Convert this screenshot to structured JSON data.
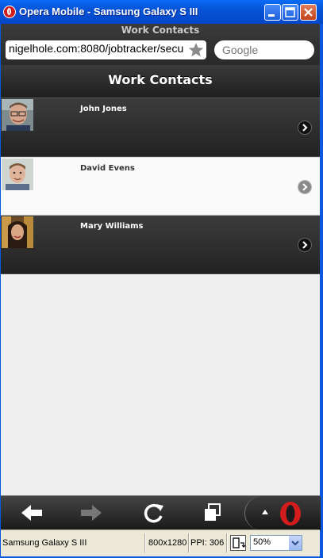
{
  "window": {
    "title": "Opera Mobile - Samsung Galaxy S III"
  },
  "browser": {
    "page_title": "Work Contacts",
    "url": "nigelhole.com:8080/jobtracker/secu",
    "search_placeholder": "Google"
  },
  "page": {
    "header": "Work Contacts",
    "contacts": [
      {
        "name": "John Jones",
        "style": "dark"
      },
      {
        "name": "David Evens",
        "style": "light"
      },
      {
        "name": "Mary Williams",
        "style": "dark"
      }
    ]
  },
  "statusbar": {
    "device": "Samsung Galaxy S III",
    "resolution": "800x1280",
    "ppi": "PPI: 306",
    "zoom": "50%"
  },
  "colors": {
    "titlebar": "#0553d6",
    "dark_row": "#2c2c2c",
    "light_row": "#fafafa",
    "opera_red": "#d31d1d"
  }
}
